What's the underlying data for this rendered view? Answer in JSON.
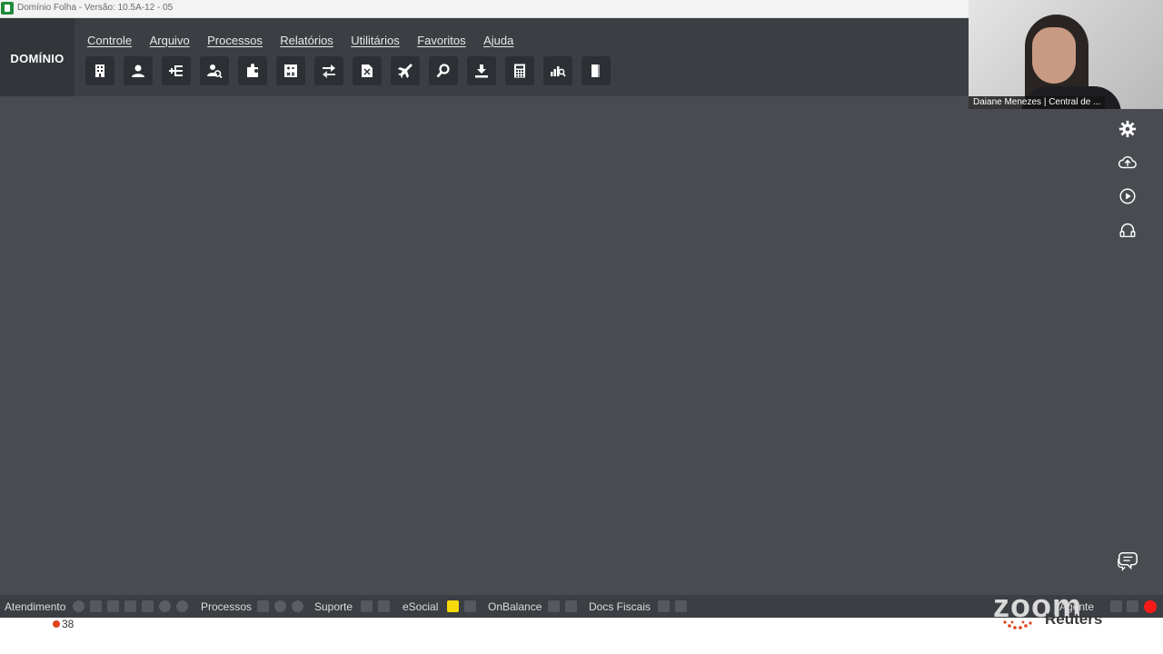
{
  "window": {
    "title": "Domínio Folha - Versão: 10.5A-12 - 05"
  },
  "brand": {
    "label": "DOMÍNIO"
  },
  "menu": [
    "Controle",
    "Arquivo",
    "Processos",
    "Relatórios",
    "Utilitários",
    "Favoritos",
    "Ajuda"
  ],
  "toolbar": {
    "icons": [
      "building-icon",
      "employee-icon",
      "list-add-icon",
      "employee-search-icon",
      "puzzle-icon",
      "calculator-grid-icon",
      "transfer-arrows-icon",
      "document-icon",
      "airplane-icon",
      "search-icon",
      "download-icon",
      "calculator-icon",
      "chart-search-icon",
      "book-icon"
    ]
  },
  "side_icons": [
    "gear-icon",
    "cloud-upload-icon",
    "play-circle-icon",
    "headset-icon"
  ],
  "video": {
    "participant_label": "Daiane Menezes | Central de ..."
  },
  "statusbar": {
    "atendimento": "Atendimento",
    "processos": "Processos",
    "suporte": "Suporte",
    "esocial": "eSocial",
    "onbalance": "OnBalance",
    "docs_fiscais": "Docs Fiscais",
    "agente": "Agente"
  },
  "overlay": {
    "zoom": "zoom",
    "reuters": "Reuters",
    "counter": "38"
  },
  "colors": {
    "workspace": "#484b50",
    "header": "#3b3e43",
    "brand_panel": "#323539",
    "record": "#ff1a1a",
    "esocial_accent": "#f5d90a"
  }
}
